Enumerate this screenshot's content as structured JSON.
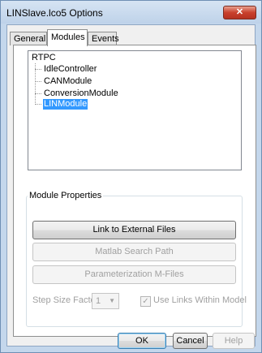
{
  "window": {
    "title": "LINSlave.lco5 Options",
    "close_label": "✕"
  },
  "tabs": [
    {
      "label": "General",
      "active": false
    },
    {
      "label": "Modules",
      "active": true
    },
    {
      "label": "Events",
      "active": false
    }
  ],
  "tree": {
    "root": "RTPC",
    "items": [
      {
        "label": "IdleController",
        "selected": false
      },
      {
        "label": "CANModule",
        "selected": false
      },
      {
        "label": "ConversionModule",
        "selected": false
      },
      {
        "label": "LINModule",
        "selected": true
      }
    ]
  },
  "module_properties": {
    "legend": "Module Properties",
    "link_external_files": "Link to External Files",
    "matlab_search_path": "Matlab Search Path",
    "parameterization_mfiles": "Parameterization M-Files",
    "step_size_label": "Step Size Factor",
    "step_size_value": "1",
    "use_links_label": "Use Links Within Model",
    "use_links_checked": true
  },
  "footer": {
    "ok": "OK",
    "cancel": "Cancel",
    "help": "Help"
  }
}
